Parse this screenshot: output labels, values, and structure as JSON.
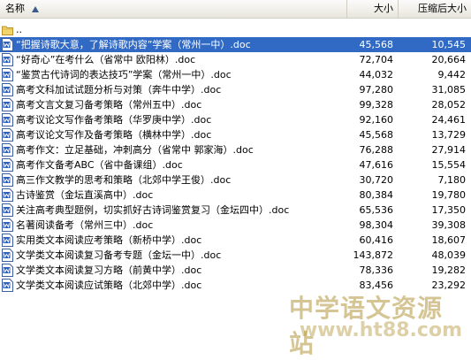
{
  "columns": {
    "name": "名称",
    "size": "大小",
    "compressed": "压缩后大小"
  },
  "parent_folder": "..",
  "files": [
    {
      "name": "“把握诗歌大意，了解诗歌内容”学案（常州一中）.doc",
      "size": "45,568",
      "compressed": "10,545",
      "selected": true
    },
    {
      "name": "“好奇心”在考什么（省常中 欧阳林）.doc",
      "size": "72,704",
      "compressed": "20,664"
    },
    {
      "name": "“鉴赏古代诗词的表达技巧”学案（常州一中）.doc",
      "size": "44,032",
      "compressed": "9,442"
    },
    {
      "name": "高考文科加试试题分析与对策（奔牛中学）.doc",
      "size": "97,280",
      "compressed": "31,085"
    },
    {
      "name": "高考文言文复习备考策略（常州五中）.doc",
      "size": "99,328",
      "compressed": "28,052"
    },
    {
      "name": "高考议论文写作备考策略（华罗庚中学）.doc",
      "size": "92,160",
      "compressed": "24,461"
    },
    {
      "name": "高考议论文写作及备考策略（横林中学）.doc",
      "size": "45,568",
      "compressed": "13,729"
    },
    {
      "name": "高考作文：立足基础，冲刺高分（省常中 郭家海）.doc",
      "size": "76,288",
      "compressed": "27,914"
    },
    {
      "name": "高考作文备考ABC（省中备课组）.doc",
      "size": "47,616",
      "compressed": "15,554"
    },
    {
      "name": "高三作文教学的思考和策略（北郊中学王俊）.doc",
      "size": "30,720",
      "compressed": "7,180"
    },
    {
      "name": "古诗鉴赏（金坛直溪高中）.doc",
      "size": "80,384",
      "compressed": "19,780"
    },
    {
      "name": "关注高考典型题例，切实抓好古诗词鉴赏复习（金坛四中）.doc",
      "size": "65,536",
      "compressed": "17,350"
    },
    {
      "name": "名著阅读备考（常州三中）.doc",
      "size": "98,304",
      "compressed": "39,308"
    },
    {
      "name": "实用类文本阅读应考策略（新桥中学）.doc",
      "size": "60,416",
      "compressed": "18,607"
    },
    {
      "name": "文学类文本阅读复习备考专题（金坛一中）.doc",
      "size": "143,872",
      "compressed": "48,039"
    },
    {
      "name": "文学类文本阅读复习方略（前黄中学）.doc",
      "size": "78,336",
      "compressed": "19,282"
    },
    {
      "name": "文学类文本阅读应试策略（北郊中学）.doc",
      "size": "83,456",
      "compressed": "23,292"
    }
  ],
  "watermark": {
    "site_name": "中学语文资源站",
    "url": "www.ht88.com"
  },
  "icons": {
    "sort": "sort-ascending-icon",
    "folder": "folder-up-icon",
    "file": "word-document-icon"
  }
}
